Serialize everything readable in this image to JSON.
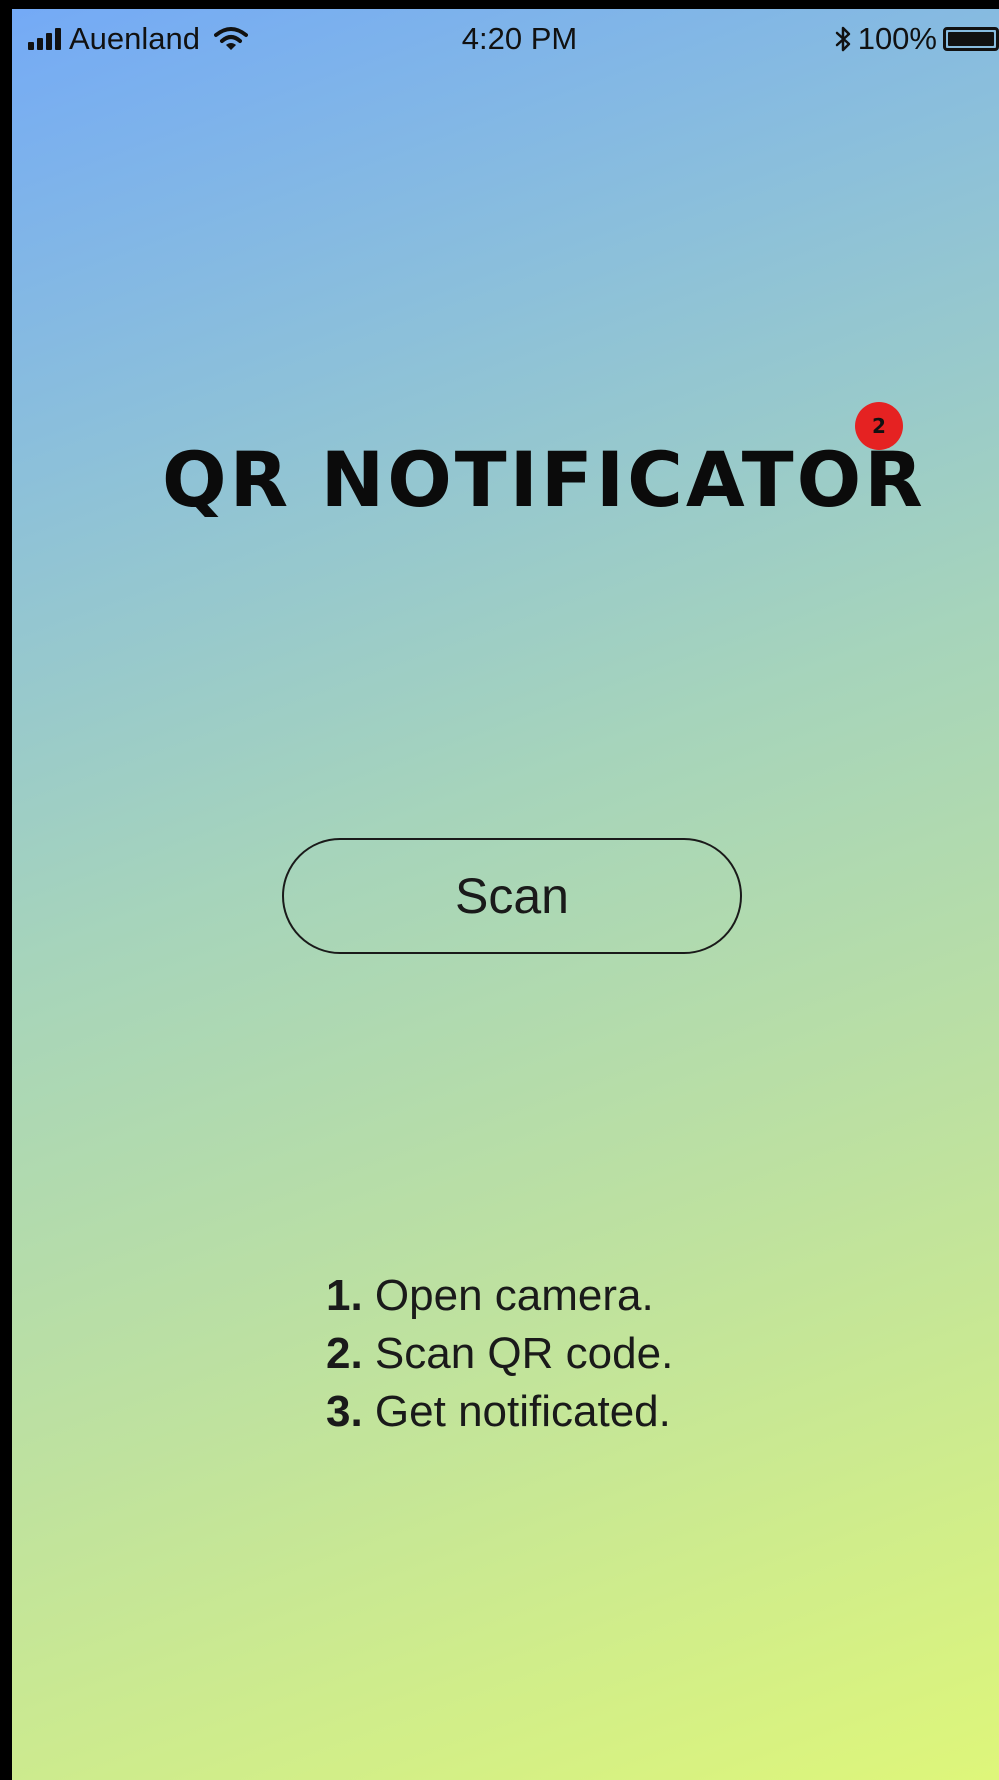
{
  "status_bar": {
    "carrier": "Auenland",
    "time": "4:20 PM",
    "battery_percent": "100%",
    "battery_level": 1.0,
    "icons": [
      "signal-icon",
      "wifi-icon",
      "bluetooth-icon",
      "battery-icon"
    ]
  },
  "app": {
    "title": "QR NOTIFICATOR",
    "badge_count": "2",
    "badge_color": "#e52222"
  },
  "scan_button": {
    "label": "Scan"
  },
  "steps": [
    {
      "number": "1.",
      "text": "Open camera."
    },
    {
      "number": "2.",
      "text": "Scan QR code."
    },
    {
      "number": "3.",
      "text": "Get notificated."
    }
  ],
  "colors": {
    "gradient_start": "#74aaf6",
    "gradient_end": "#def67a"
  }
}
